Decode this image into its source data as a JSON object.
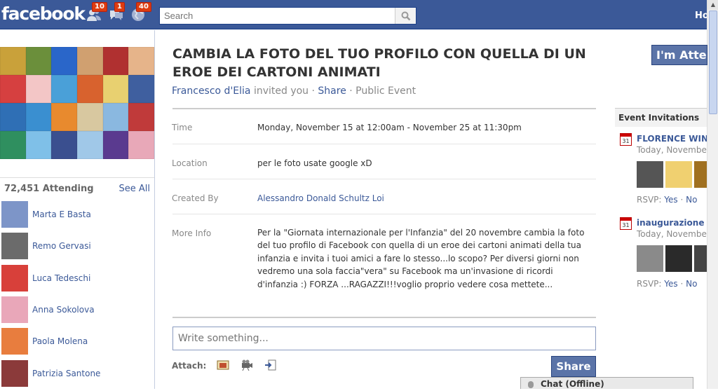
{
  "header": {
    "logo": "facebook",
    "badges": {
      "friend_requests": "10",
      "messages": "1",
      "notifications": "40"
    },
    "search_placeholder": "Search",
    "home_label": "Ho"
  },
  "event": {
    "title": "CAMBIA LA FOTO DEL TUO PROFILO CON QUELLA DI UN EROE DEI CARTONI ANIMATI",
    "inviter": "Francesco d'Elia",
    "invited_text": " invited you · ",
    "share_link": "Share",
    "visibility": " · Public Event",
    "rows": {
      "time_label": "Time",
      "time_value": "Monday, November 15 at 12:00am - November 25 at 11:30pm",
      "location_label": "Location",
      "location_value": "per le foto usate google xD",
      "created_label": "Created By",
      "created_value": "Alessandro Donald Schultz Loi",
      "more_label": "More Info",
      "more_value": "Per la \"Giornata internazionale per l'Infanzia\" del 20 novembre cambia la foto del tuo profilo di Facebook con quella di un eroe dei cartoni animati della tua infanzia e invita i tuoi amici a fare lo stesso...lo scopo? Per diversi giorni non vedremo una sola faccia\"vera\" su Facebook ma un'invasione di ricordi d'infanzia :) FORZA ...RAGAZZI!!!voglio proprio vedere cosa mettete..."
    },
    "attend_button": "I'm Attending",
    "write_placeholder": "Write something...",
    "attach_label": "Attach:",
    "share_button": "Share"
  },
  "attending": {
    "count": "72,451 Attending",
    "see_all": "See All",
    "people": [
      {
        "name": "Marta E Basta",
        "color": "#7d95c8"
      },
      {
        "name": "Remo Gervasi",
        "color": "#6b6b6b"
      },
      {
        "name": "Luca Tedeschi",
        "color": "#d8403a"
      },
      {
        "name": "Anna Sokolova",
        "color": "#e9a7b9"
      },
      {
        "name": "Paola Molena",
        "color": "#e87d3e"
      },
      {
        "name": "Patrizia Santone",
        "color": "#8b3a3a"
      }
    ]
  },
  "sidebar": {
    "heading": "Event Invitations",
    "invites": [
      {
        "name": "FLORENCE WINE",
        "date": "Today, November",
        "rsvp_label": "RSVP: ",
        "yes": "Yes",
        "sep": " · ",
        "no": "No"
      },
      {
        "name": "inaugurazione E",
        "date": "Today, November",
        "rsvp_label": "RSVP: ",
        "yes": "Yes",
        "sep": " · ",
        "no": "No"
      }
    ],
    "calendar_day": "31"
  },
  "chat": {
    "label": "Chat (Offline)"
  },
  "colors": {
    "brand": "#3b5998",
    "badge": "#dd3c10",
    "button": "#5b74a8"
  }
}
